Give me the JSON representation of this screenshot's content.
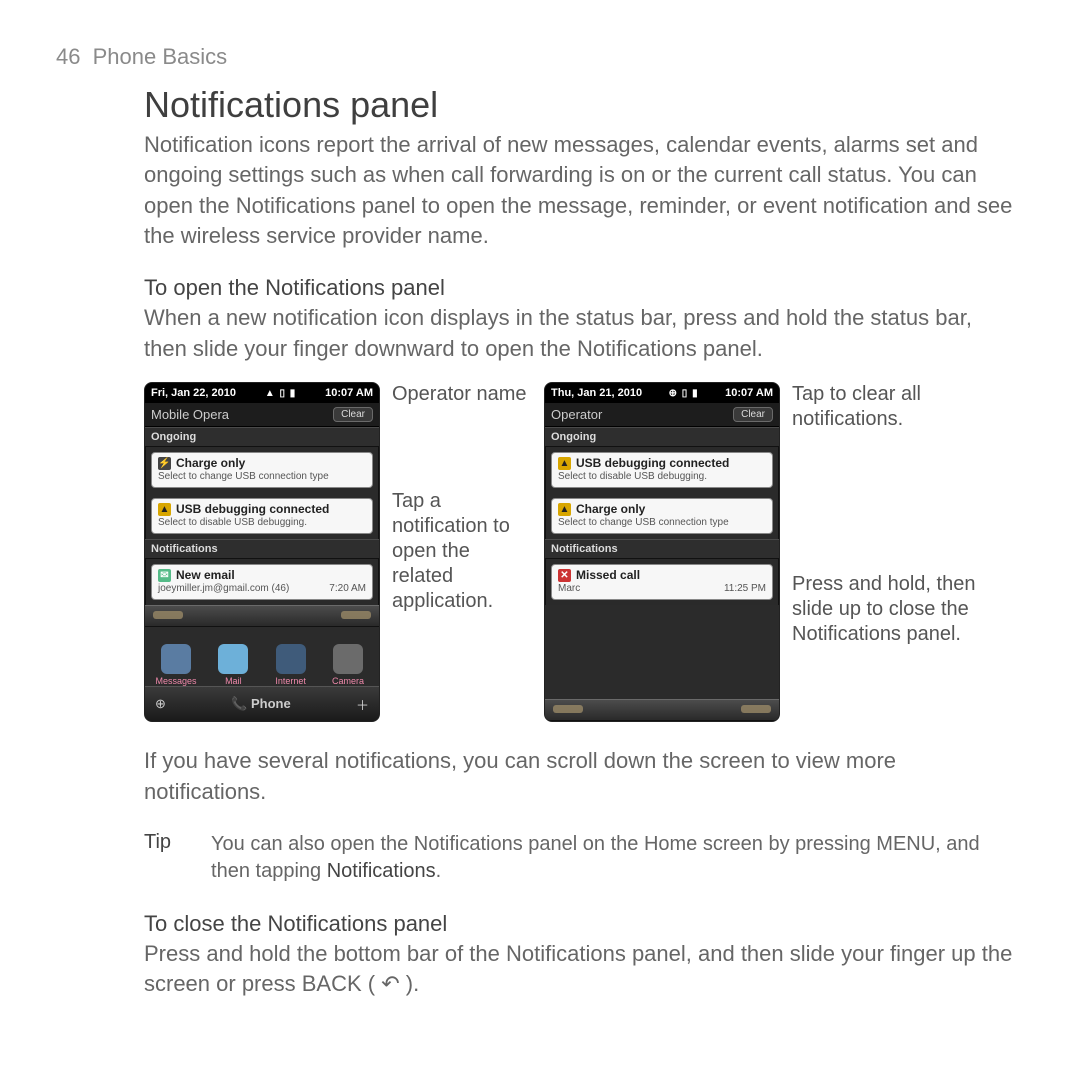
{
  "header": {
    "page_number": "46",
    "chapter": "Phone Basics"
  },
  "section": {
    "title": "Notifications panel",
    "intro": "Notification icons report the arrival of new messages, calendar events, alarms set and ongoing settings such as when call forwarding is on or the current call status. You can open the Notifications panel to open the message, reminder, or event notification and see the wireless service provider name."
  },
  "open": {
    "heading": "To open the Notifications panel",
    "text": "When a new notification icon displays in the status bar, press and hold the status bar, then slide your finger downward to open the Notifications panel."
  },
  "figure": {
    "notes_left": {
      "operator": "Operator name",
      "tap": "Tap a notification to open the related application."
    },
    "notes_right": {
      "clear": "Tap to clear all notifications.",
      "close": "Press and hold, then slide up to close the Notifications panel."
    },
    "phone1": {
      "status_date": "Fri, Jan 22, 2010",
      "status_time": "10:07 AM",
      "operator": "Mobile Opera",
      "clear_label": "Clear",
      "ongoing_hdr": "Ongoing",
      "n1_title": "Charge only",
      "n1_sub": "Select to change USB connection type",
      "n2_title": "USB debugging connected",
      "n2_sub": "Select to disable USB debugging.",
      "notif_hdr": "Notifications",
      "n3_title": "New email",
      "n3_sub": "joeymiller.jm@gmail.com (46)",
      "n3_time": "7:20 AM",
      "apps": {
        "a1": "Messages",
        "a2": "Mail",
        "a3": "Internet",
        "a4": "Camera"
      },
      "phone_btn": "Phone"
    },
    "phone2": {
      "status_date": "Thu, Jan 21, 2010",
      "status_time": "10:07 AM",
      "operator": "Operator",
      "clear_label": "Clear",
      "ongoing_hdr": "Ongoing",
      "n1_title": "USB debugging connected",
      "n1_sub": "Select to disable USB debugging.",
      "n2_title": "Charge only",
      "n2_sub": "Select to change USB connection type",
      "notif_hdr": "Notifications",
      "n3_title": "Missed call",
      "n3_sub": "Marc",
      "n3_time": "11:25 PM"
    }
  },
  "after_figure": "If you have several notifications, you can scroll down the screen to view more notifications.",
  "tip": {
    "label": "Tip",
    "text_before": "You can also open the Notifications panel on the Home screen by pressing MENU, and then tapping ",
    "keyword": "Notifications",
    "text_after": "."
  },
  "close": {
    "heading": "To close the Notifications panel",
    "text_before": "Press and hold the bottom bar of the Notifications panel, and then slide your finger up the screen or press BACK ( ",
    "back_glyph": "↶",
    "text_after": " )."
  }
}
